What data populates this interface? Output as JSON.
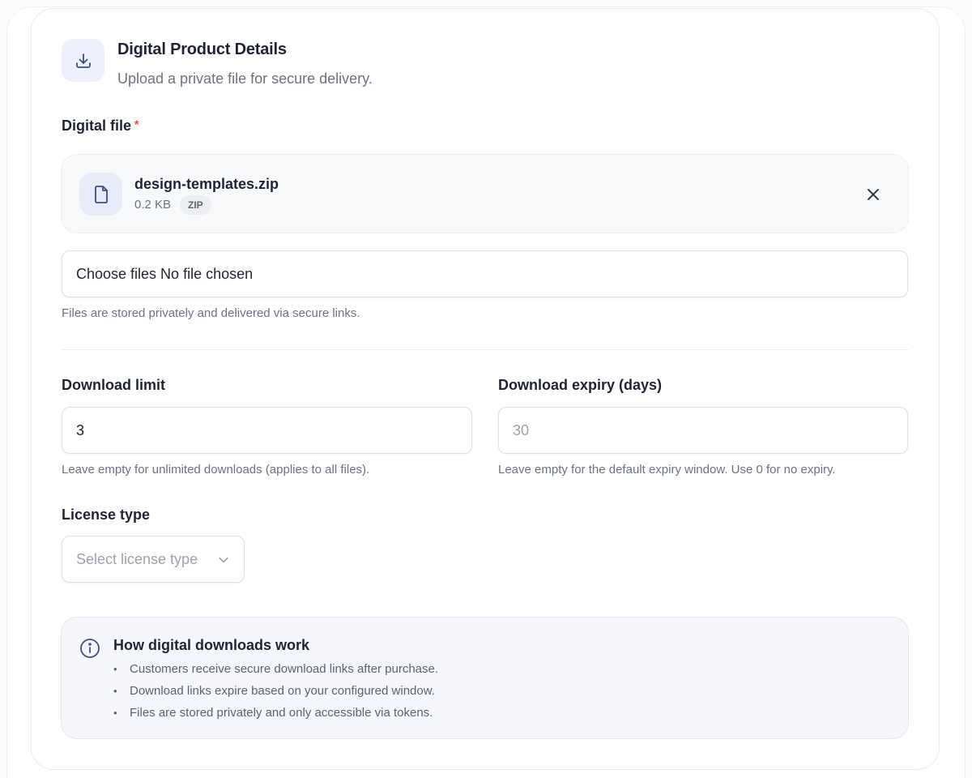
{
  "header": {
    "title": "Digital Product Details",
    "subtitle": "Upload a private file for secure delivery.",
    "icon": "download-icon"
  },
  "digital_file": {
    "label": "Digital file",
    "required_marker": "*",
    "file": {
      "name": "design-templates.zip",
      "size": "0.2 KB",
      "type_badge": "ZIP",
      "icon": "file-icon"
    },
    "file_input_text": "Choose files No file chosen",
    "help": "Files are stored privately and delivered via secure links."
  },
  "download_limit": {
    "label": "Download limit",
    "value": "3",
    "help": "Leave empty for unlimited downloads (applies to all files)."
  },
  "download_expiry": {
    "label": "Download expiry (days)",
    "placeholder": "30",
    "help": "Leave empty for the default expiry window. Use 0 for no expiry."
  },
  "license_type": {
    "label": "License type",
    "placeholder": "Select license type"
  },
  "info": {
    "title": "How digital downloads work",
    "items": [
      "Customers receive secure download links after purchase.",
      "Download links expire based on your configured window.",
      "Files are stored privately and only accessible via tokens."
    ]
  },
  "colors": {
    "accent": "#4a5b9c",
    "required": "#e0454d",
    "info_bg": "#f5f7fc"
  }
}
